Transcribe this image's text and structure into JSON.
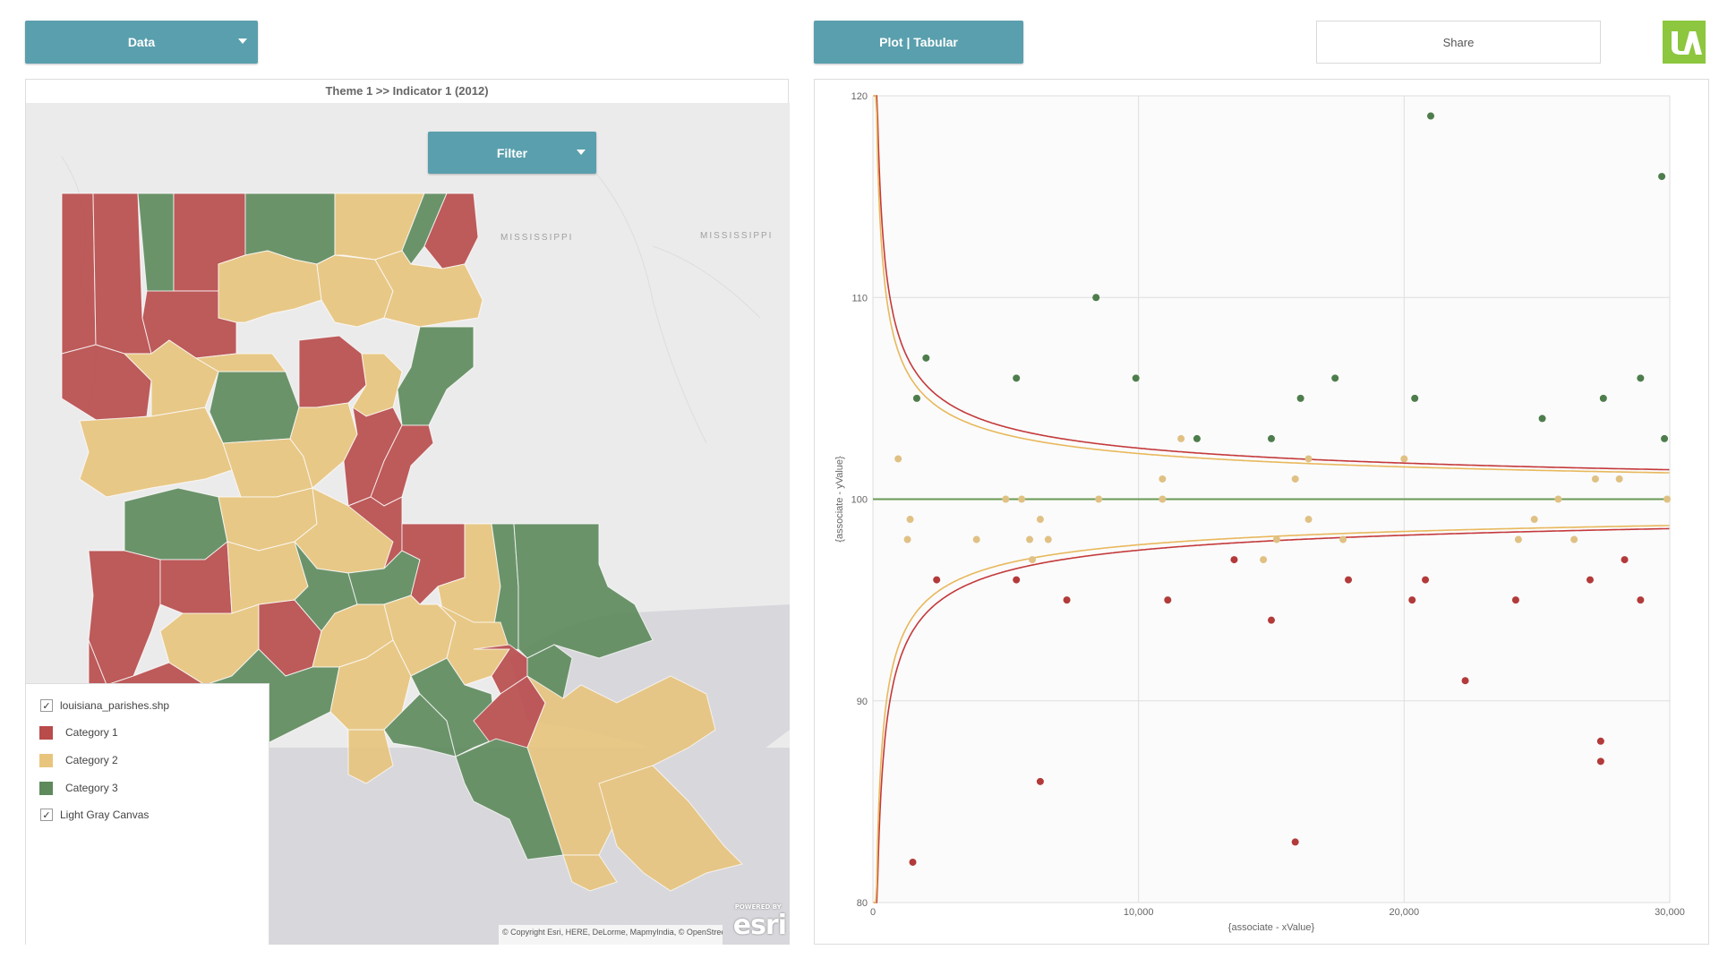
{
  "toolbar": {
    "data_label": "Data",
    "plot_label": "Plot | Tabular",
    "share_label": "Share",
    "logo_text": "IA"
  },
  "map": {
    "title": "Theme 1 >>  Indicator 1 (2012)",
    "filter_label": "Filter",
    "state_labels": [
      "MISSISSIPPI",
      "MISSISSIPPI"
    ],
    "copyright": "© Copyright Esri, HERE, DeLorme, MapmyIndia, © OpenStreetMap contributors, and the GIS user",
    "esri_powered": "POWERED BY",
    "esri_logo": "esri",
    "legend": {
      "layer_label": "louisiana_parishes.shp",
      "layer_checked": true,
      "categories": [
        {
          "label": "Category 1",
          "color": "#b94b4b"
        },
        {
          "label": "Category 2",
          "color": "#e8c57d"
        },
        {
          "label": "Category 3",
          "color": "#5e8a5c"
        }
      ],
      "basemap_label": "Light Gray Canvas",
      "basemap_checked": true
    }
  },
  "chart_data": {
    "type": "scatter",
    "xlabel": "{associate - xValue}",
    "ylabel": "{associate - yValue}",
    "xlim": [
      0,
      30000
    ],
    "ylim": [
      80,
      120
    ],
    "xticks": [
      0,
      10000,
      20000,
      30000
    ],
    "xtick_labels": [
      "0",
      "10,000",
      "20,000",
      "30,000"
    ],
    "yticks": [
      80,
      90,
      100,
      110,
      120
    ],
    "ytick_labels": [
      "80",
      "90",
      "100",
      "110",
      "120"
    ],
    "grid": true,
    "mean_line": {
      "y": 100,
      "color": "#6a9a55"
    },
    "control_limits": [
      {
        "color": "#c4393b",
        "k": 25000
      },
      {
        "color": "#e8b85c",
        "k": 20000
      }
    ],
    "series": [
      {
        "color": "#b33a3a",
        "points": [
          [
            1500,
            82
          ],
          [
            2400,
            96
          ],
          [
            5400,
            96
          ],
          [
            6300,
            86
          ],
          [
            7300,
            95
          ],
          [
            11100,
            95
          ],
          [
            13600,
            97
          ],
          [
            15000,
            94
          ],
          [
            15900,
            83
          ],
          [
            17900,
            96
          ],
          [
            20300,
            95
          ],
          [
            20800,
            96
          ],
          [
            22300,
            91
          ],
          [
            24200,
            95
          ],
          [
            27000,
            96
          ],
          [
            27400,
            88
          ],
          [
            27400,
            87
          ],
          [
            28300,
            97
          ],
          [
            28900,
            95
          ]
        ]
      },
      {
        "color": "#e0c184",
        "points": [
          [
            950,
            102
          ],
          [
            1300,
            98
          ],
          [
            1400,
            99
          ],
          [
            3900,
            98
          ],
          [
            5000,
            100
          ],
          [
            5600,
            100
          ],
          [
            5900,
            98
          ],
          [
            6000,
            97
          ],
          [
            6300,
            99
          ],
          [
            6600,
            98
          ],
          [
            8500,
            100
          ],
          [
            10900,
            101
          ],
          [
            10900,
            100
          ],
          [
            11600,
            103
          ],
          [
            14700,
            97
          ],
          [
            15200,
            98
          ],
          [
            15900,
            101
          ],
          [
            16400,
            102
          ],
          [
            16400,
            99
          ],
          [
            17700,
            98
          ],
          [
            20000,
            102
          ],
          [
            24300,
            98
          ],
          [
            24900,
            99
          ],
          [
            25800,
            100
          ],
          [
            26400,
            98
          ],
          [
            27200,
            101
          ],
          [
            28100,
            101
          ],
          [
            29900,
            100
          ]
        ]
      },
      {
        "color": "#4e7d4c",
        "points": [
          [
            1650,
            105
          ],
          [
            2000,
            107
          ],
          [
            5400,
            106
          ],
          [
            8400,
            110
          ],
          [
            9900,
            106
          ],
          [
            12200,
            103
          ],
          [
            15000,
            103
          ],
          [
            16100,
            105
          ],
          [
            17400,
            106
          ],
          [
            20400,
            105
          ],
          [
            21000,
            119
          ],
          [
            25200,
            104
          ],
          [
            27500,
            105
          ],
          [
            28900,
            106
          ],
          [
            29700,
            116
          ],
          [
            29800,
            103
          ]
        ]
      }
    ]
  }
}
